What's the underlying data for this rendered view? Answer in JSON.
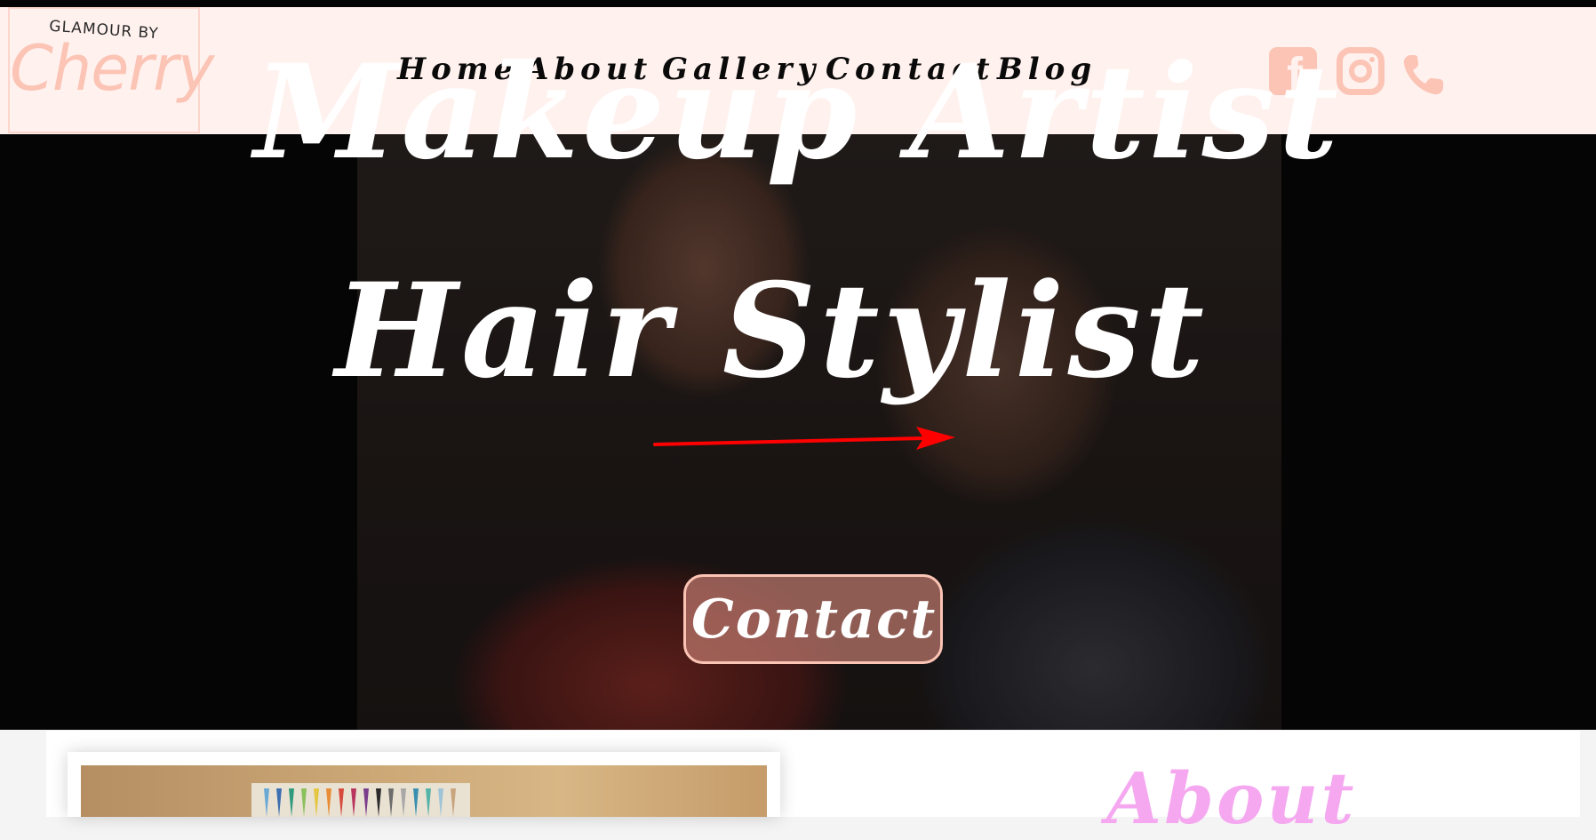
{
  "header": {
    "logo": {
      "subtitle": "GLAMOUR BY",
      "name": "Cherry"
    },
    "nav": [
      {
        "label": "Home"
      },
      {
        "label": "About"
      },
      {
        "label": "Gallery"
      },
      {
        "label": "Contact"
      },
      {
        "label": "Blog"
      }
    ],
    "social": {
      "facebook_icon": "facebook-icon",
      "instagram_icon": "instagram-icon",
      "phone_icon": "phone-icon"
    }
  },
  "hero": {
    "line1": "Makeup Artist",
    "line2": "Hair Stylist",
    "cta_label": "Contact"
  },
  "about": {
    "heading": "About"
  },
  "colors": {
    "accent_pink": "#fbc4b5",
    "header_bg": "#fff1ee",
    "about_heading": "#f5a8f0",
    "annotation_arrow": "#ff0000"
  }
}
